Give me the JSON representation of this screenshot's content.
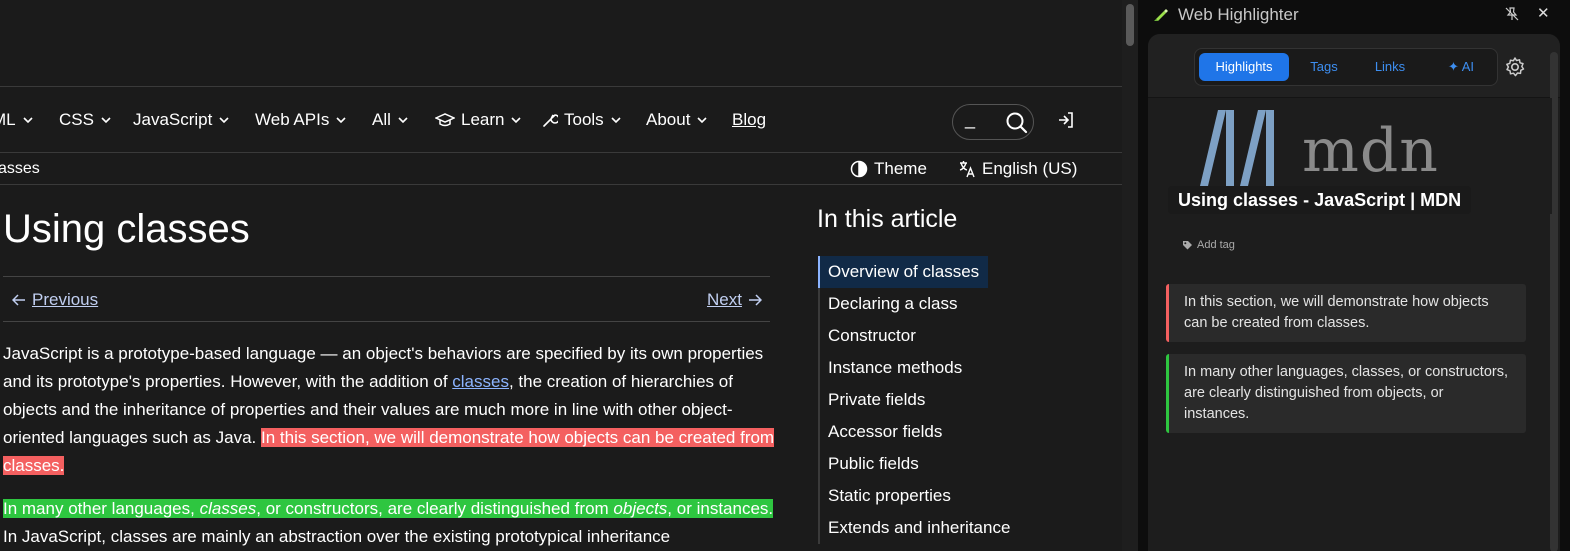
{
  "nav": {
    "items": [
      {
        "label": "ML"
      },
      {
        "label": "CSS"
      },
      {
        "label": "JavaScript"
      },
      {
        "label": "Web APIs"
      },
      {
        "label": "All"
      },
      {
        "label": "Learn"
      },
      {
        "label": "Tools"
      },
      {
        "label": "About"
      }
    ],
    "blog": "Blog",
    "search_value": "_"
  },
  "breadcrumb": "asses",
  "toolbar": {
    "theme": "Theme",
    "language": "English (US)"
  },
  "article": {
    "title": "Using classes",
    "previous": "Previous",
    "next": "Next",
    "p1_a": "JavaScript is a prototype-based language — an object's behaviors are specified by its own properties and its prototype's properties. However, with the addition of ",
    "p1_link": "classes",
    "p1_b": ", the creation of hierarchies of objects and the inheritance of properties and their values are much more in line with other object-oriented languages such as Java. ",
    "p1_highlight": "In this section, we will demonstrate how objects can be created from classes.",
    "p2_hl_1": "In many other languages, ",
    "p2_hl_em1": "classes",
    "p2_hl_2": ", or constructors, are clearly distinguished from ",
    "p2_hl_em2": "objects",
    "p2_hl_3": ", or instances.",
    "p2_rest": " In JavaScript, classes are mainly an abstraction over the existing prototypical inheritance"
  },
  "toc": {
    "title": "In this article",
    "items": [
      "Overview of classes",
      "Declaring a class",
      "Constructor",
      "Instance methods",
      "Private fields",
      "Accessor fields",
      "Public fields",
      "Static properties",
      "Extends and inheritance"
    ]
  },
  "extension": {
    "title": "Web Highlighter",
    "tabs": [
      "Highlights",
      "Tags",
      "Links",
      "AI"
    ],
    "logo_word": "mdn",
    "page_title": "Using classes - JavaScript | MDN",
    "add_tag": "Add tag",
    "highlights": [
      {
        "text": "In this section, we will demonstrate how objects can be created from classes.",
        "color": "#f46060"
      },
      {
        "text": "In many other languages, classes, or constructors, are clearly distinguished from objects, or instances.",
        "color": "#2ec640"
      }
    ]
  },
  "colors": {
    "accent": "#1f75e8",
    "red_highlight": "#f46060",
    "green_highlight": "#2ec640",
    "link": "#8cb4ff"
  }
}
